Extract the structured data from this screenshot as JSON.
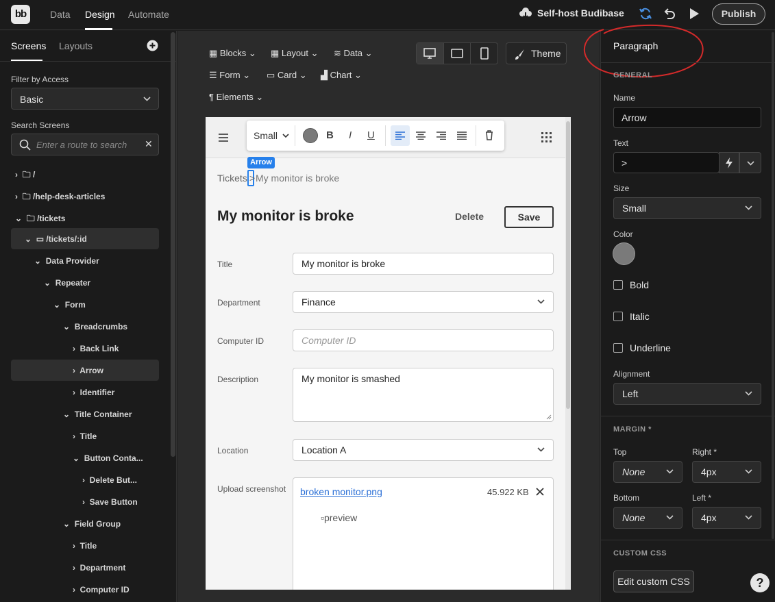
{
  "app": {
    "logo": "bb"
  },
  "topnav": {
    "tabs": [
      "Data",
      "Design",
      "Automate"
    ],
    "selfhost": "Self-host Budibase",
    "publish": "Publish"
  },
  "left": {
    "tabs": [
      "Screens",
      "Layouts"
    ],
    "filter_label": "Filter by Access",
    "filter_value": "Basic",
    "search_label": "Search Screens",
    "search_placeholder": "Enter a route to search",
    "tree": [
      "/",
      "/help-desk-articles",
      "/tickets",
      "/tickets/:id",
      "Data Provider",
      "Repeater",
      "Form",
      "Breadcrumbs",
      "Back Link",
      "Arrow",
      "Identifier",
      "Title Container",
      "Title",
      "Button Conta...",
      "Delete But...",
      "Save Button",
      "Field Group",
      "Title",
      "Department",
      "Computer ID"
    ]
  },
  "toolbar": {
    "row1": [
      "Blocks",
      "Layout",
      "Data"
    ],
    "row2": [
      "Form",
      "Card",
      "Chart"
    ],
    "row3": [
      "Elements"
    ],
    "theme": "Theme"
  },
  "format": {
    "size": "Small",
    "bold": "B",
    "italic": "I",
    "underline": "U",
    "color": "#7a7a7a"
  },
  "preview": {
    "tag": "Arrow",
    "crumb_back": "Tickets",
    "crumb_arrow": ">",
    "crumb_current": "My monitor is broke",
    "title": "My monitor is broke",
    "delete": "Delete",
    "save": "Save",
    "fields": [
      {
        "label": "Title",
        "value": "My monitor is broke"
      },
      {
        "label": "Department",
        "value": "Finance"
      },
      {
        "label": "Computer ID",
        "placeholder": "Computer ID"
      },
      {
        "label": "Description",
        "value": "My monitor is smashed"
      },
      {
        "label": "Location",
        "value": "Location A"
      },
      {
        "label": "Upload screenshot"
      }
    ],
    "file_name": "broken monitor.png",
    "file_size": "45.922 KB",
    "img_alt": "preview"
  },
  "right": {
    "title": "Paragraph",
    "general": "GENERAL",
    "name_label": "Name",
    "name_value": "Arrow",
    "text_label": "Text",
    "text_value": ">",
    "size_label": "Size",
    "size_value": "Small",
    "color_label": "Color",
    "bold": "Bold",
    "italic": "Italic",
    "underline": "Underline",
    "align_label": "Alignment",
    "align_value": "Left",
    "margin": "MARGIN *",
    "top_label": "Top",
    "top_value": "None",
    "right_label": "Right *",
    "right_value": "4px",
    "bottom_label": "Bottom",
    "bottom_value": "None",
    "left_label": "Left *",
    "left_value": "4px",
    "custom_css": "CUSTOM CSS",
    "edit_css": "Edit custom CSS",
    "help": "?"
  },
  "colors": {
    "accent": "#4a90e2",
    "annotation": "#d42a2a",
    "swatch": "#7a7a7a"
  }
}
